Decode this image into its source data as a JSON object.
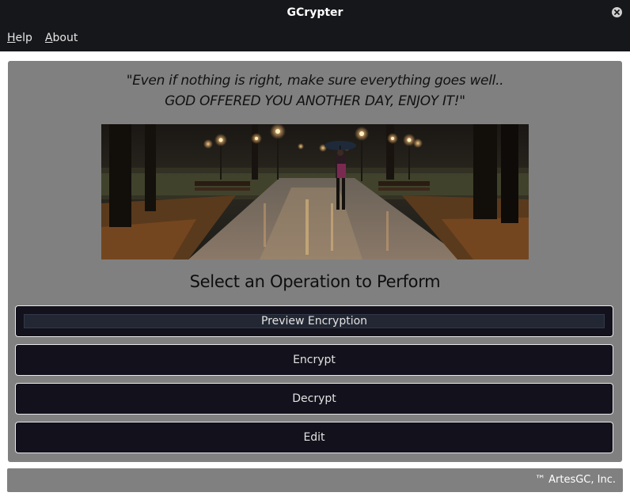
{
  "window": {
    "title": "GCrypter"
  },
  "menu": {
    "items": [
      {
        "mnemonic": "H",
        "rest": "elp"
      },
      {
        "mnemonic": "A",
        "rest": "bout"
      }
    ]
  },
  "quote": {
    "line1": "\"Even if nothing is right, make sure everything goes well..",
    "line2": "GOD OFFERED YOU ANOTHER DAY, ENJOY IT!\""
  },
  "heading": "Select an Operation to Perform",
  "operations": [
    {
      "label": "Preview Encryption",
      "focused": true
    },
    {
      "label": "Encrypt"
    },
    {
      "label": "Decrypt"
    },
    {
      "label": "Edit"
    }
  ],
  "footer": {
    "copyright": "™ ArtesGC, Inc."
  },
  "colors": {
    "titlebar": "#16171a",
    "panel": "#808080",
    "button": "#12111c"
  }
}
